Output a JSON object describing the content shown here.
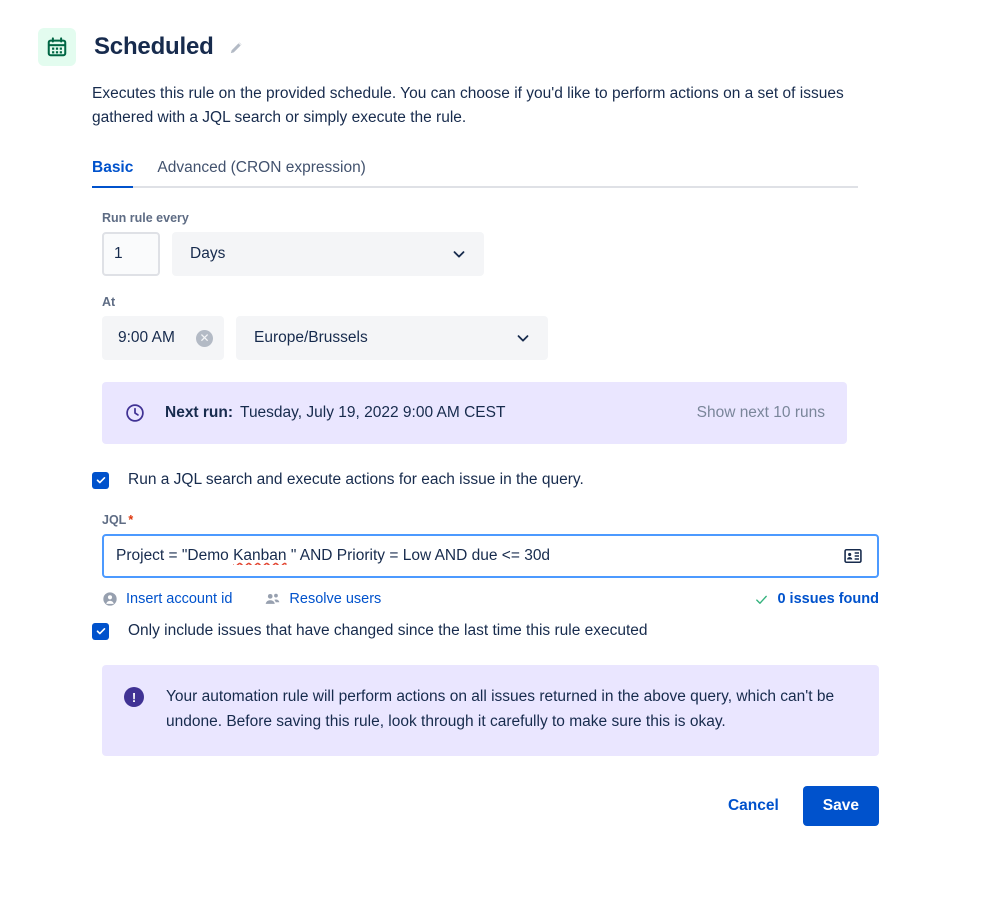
{
  "header": {
    "icon": "calendar-icon",
    "title": "Scheduled",
    "edit_icon": "pencil-icon",
    "description": "Executes this rule on the provided schedule. You can choose if you'd like to perform actions on a set of issues gathered with a JQL search or simply execute the rule."
  },
  "tabs": [
    {
      "label": "Basic",
      "active": true
    },
    {
      "label": "Advanced (CRON expression)",
      "active": false
    }
  ],
  "schedule": {
    "run_every_label": "Run rule every",
    "interval_value": "1",
    "interval_placeholder": "1",
    "frequency_value": "Days",
    "at_label": "At",
    "time_value": "9:00 AM",
    "timezone_value": "Europe/Brussels",
    "clear_time_icon": "clear-circle-icon",
    "chevron_icon": "chevron-down-icon"
  },
  "next_run": {
    "icon": "clock-icon",
    "label": "Next run:",
    "value": "Tuesday, July 19, 2022 9:00 AM CEST",
    "link": "Show next 10 runs"
  },
  "jql_toggle": {
    "checked": true,
    "label": "Run a JQL search and execute actions for each issue in the query."
  },
  "jql": {
    "label": "JQL",
    "required_marker": "*",
    "query_before": "Project = \"Demo ",
    "query_misspelled": "Kanban",
    "query_after": " \" AND Priority = Low AND due <= 30d",
    "full_query": "Project = \"Demo Kanban \" AND Priority = Low AND due <= 30d",
    "field_icon": "contact-card-icon",
    "links": [
      {
        "label": "Insert account id",
        "icon": "person-icon"
      },
      {
        "label": "Resolve users",
        "icon": "people-icon"
      }
    ],
    "result": {
      "icon": "check-icon",
      "label": "0 issues found"
    }
  },
  "changed_only_toggle": {
    "checked": true,
    "label": "Only include issues that have changed since the last time this rule executed"
  },
  "warning": {
    "icon": "exclamation-icon",
    "text": "Your automation rule will perform actions on all issues returned in the above query, which can't be undone. Before saving this rule, look through it carefully to make sure this is okay."
  },
  "footer": {
    "cancel_label": "Cancel",
    "save_label": "Save"
  },
  "colors": {
    "brand_blue": "#0052CC",
    "focus_blue": "#4C9AFF",
    "purple_banner": "#EAE6FF",
    "purple_dark": "#403294",
    "green_icon_bg": "#E3FCEF",
    "green_icon": "#006644",
    "success_green": "#36B37E",
    "required_red": "#DE350B",
    "text_dark": "#172B4D",
    "text_subtle": "#5E6C84",
    "text_muted": "#7A869A",
    "field_bg": "#F4F5F7"
  }
}
